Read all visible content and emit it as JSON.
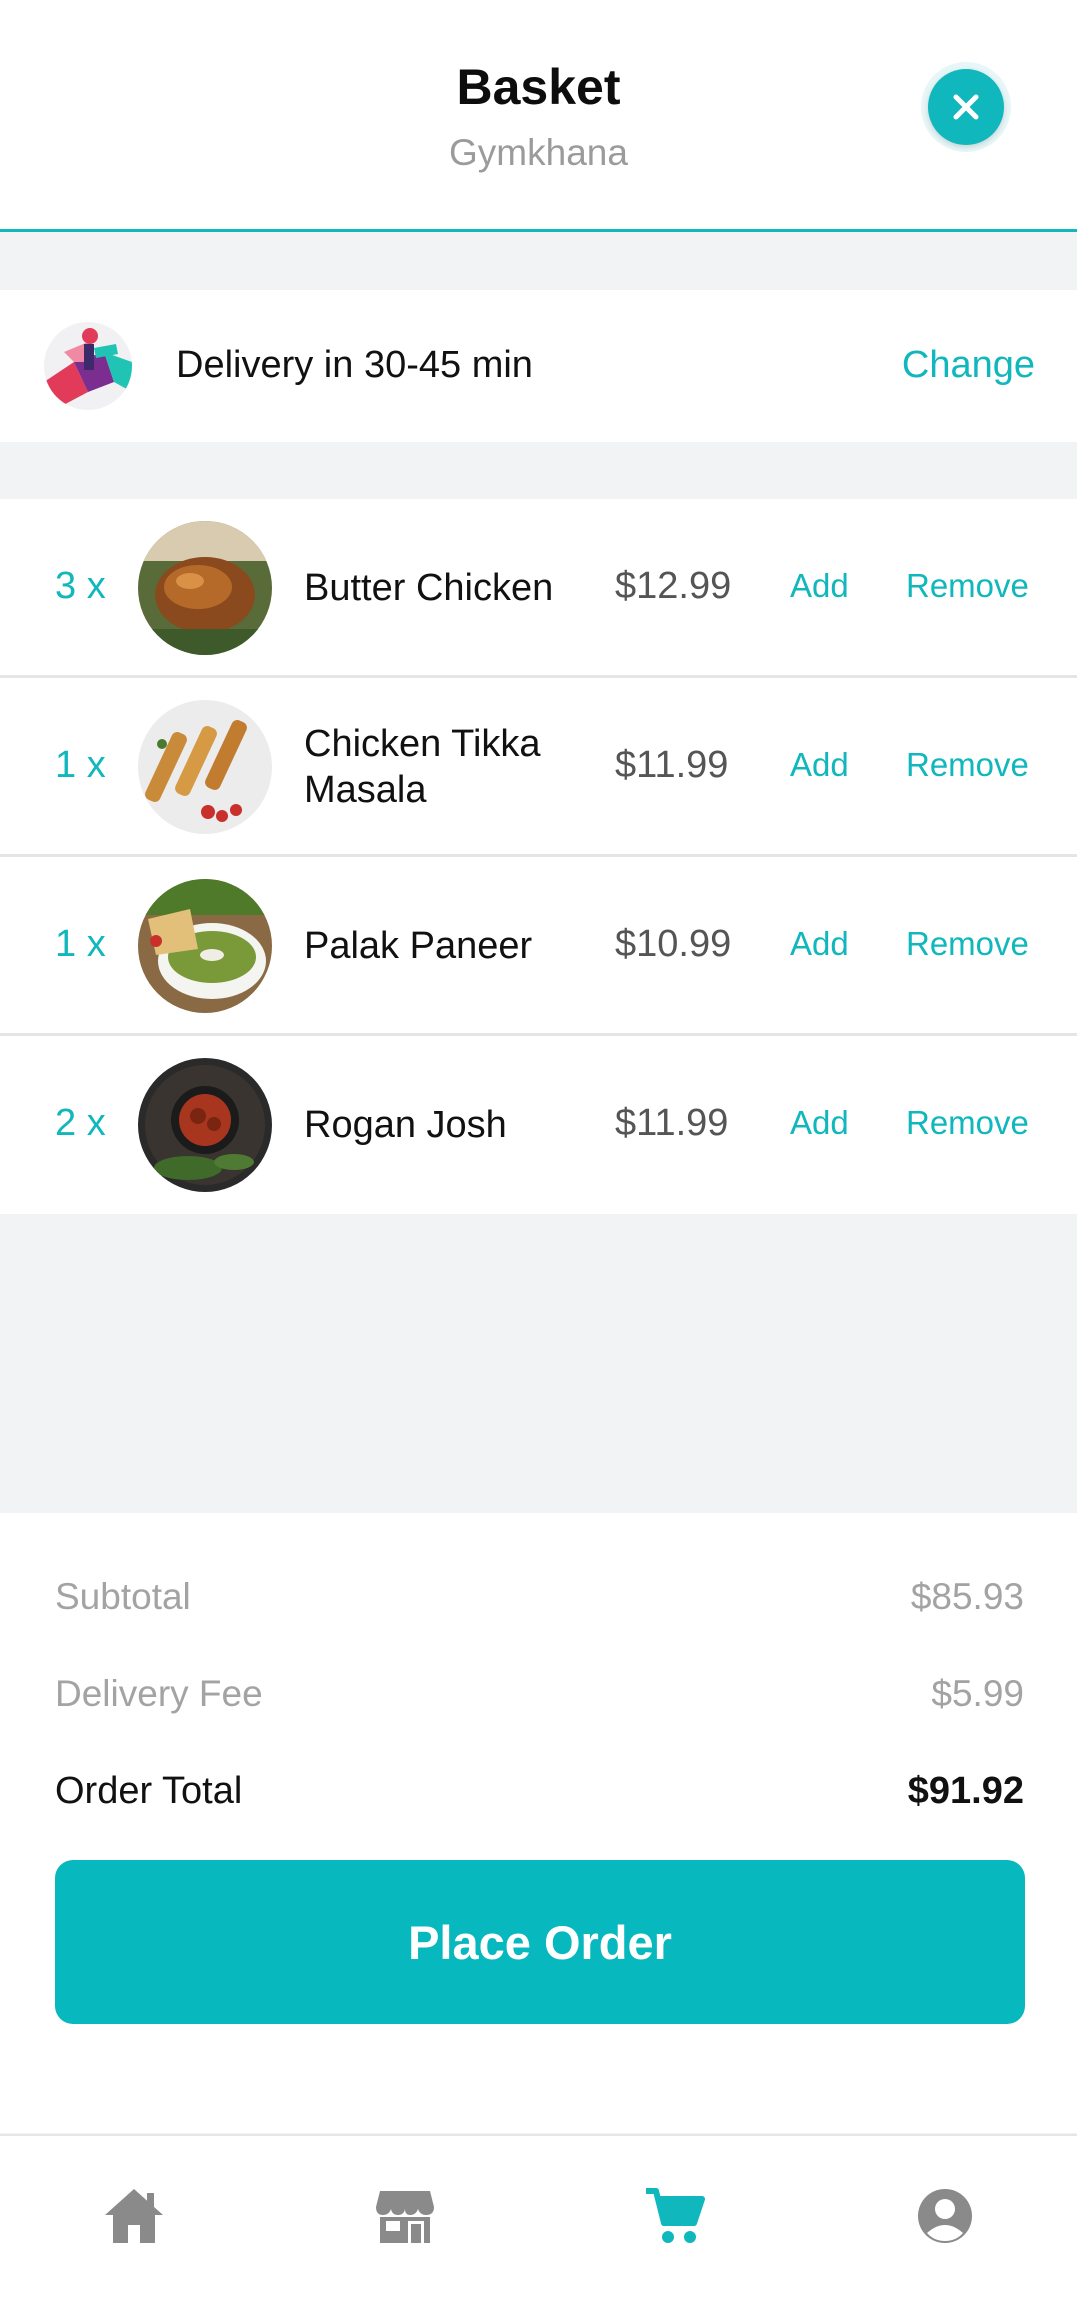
{
  "header": {
    "title": "Basket",
    "subtitle": "Gymkhana",
    "close_icon": "close-icon"
  },
  "delivery": {
    "text": "Delivery in 30-45 min",
    "change_label": "Change",
    "avatar_icon": "delivery-courier-icon"
  },
  "items": [
    {
      "qty": "3 x",
      "name": "Butter Chicken",
      "price": "$12.99",
      "add": "Add",
      "remove": "Remove"
    },
    {
      "qty": "1 x",
      "name": "Chicken Tikka Masala",
      "price": "$11.99",
      "add": "Add",
      "remove": "Remove"
    },
    {
      "qty": "1 x",
      "name": "Palak Paneer",
      "price": "$10.99",
      "add": "Add",
      "remove": "Remove"
    },
    {
      "qty": "2 x",
      "name": "Rogan Josh",
      "price": "$11.99",
      "add": "Add",
      "remove": "Remove"
    }
  ],
  "summary": {
    "subtotal_label": "Subtotal",
    "subtotal_value": "$85.93",
    "delivery_fee_label": "Delivery Fee",
    "delivery_fee_value": "$5.99",
    "total_label": "Order Total",
    "total_value": "$91.92",
    "place_order_label": "Place Order"
  },
  "nav": {
    "items": [
      {
        "icon": "home-icon",
        "active": false
      },
      {
        "icon": "store-icon",
        "active": false
      },
      {
        "icon": "cart-icon",
        "active": true
      },
      {
        "icon": "account-icon",
        "active": false
      }
    ]
  },
  "colors": {
    "accent": "#10b7bd",
    "muted": "#a3a3a3",
    "nav_inactive": "#8a8a8a"
  }
}
